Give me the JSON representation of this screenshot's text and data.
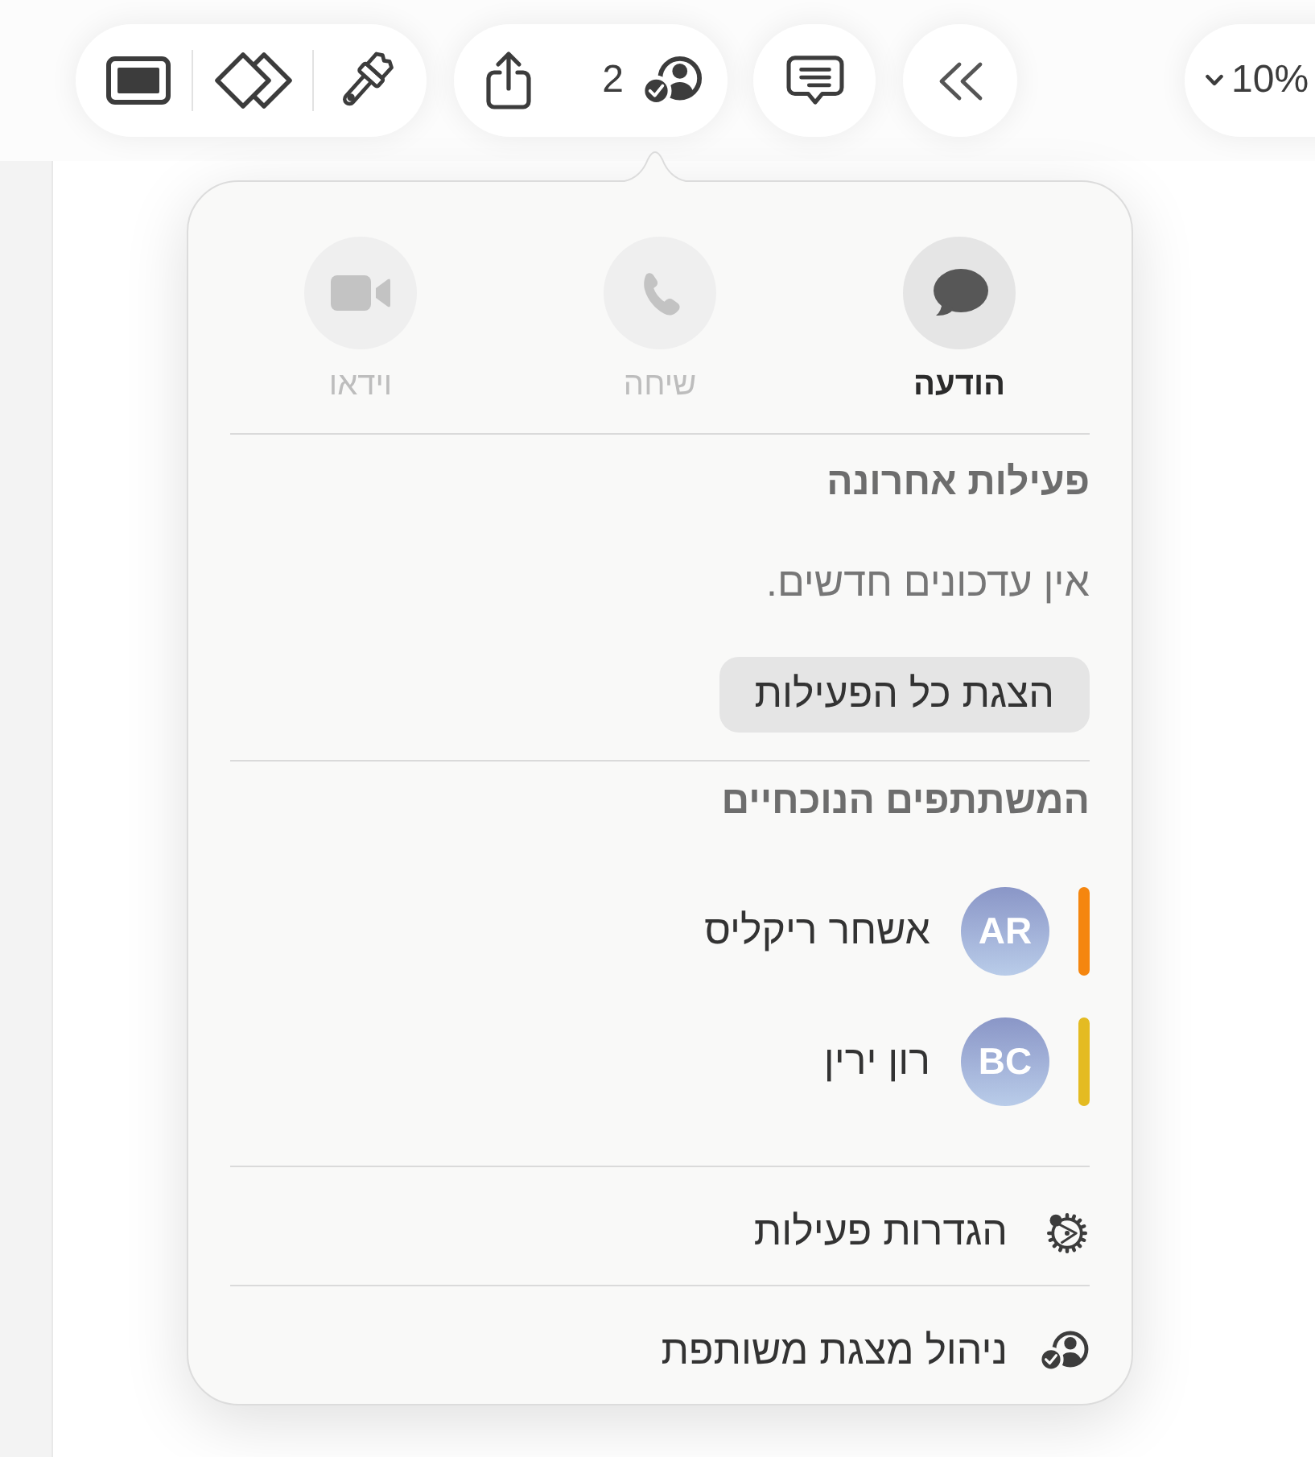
{
  "toolbar": {
    "collaborator_count": "2",
    "zoom": "10%"
  },
  "popover": {
    "actions": [
      {
        "kind": "message",
        "label": "הודעה",
        "disabled": false
      },
      {
        "kind": "call",
        "label": "שיחה",
        "disabled": true
      },
      {
        "kind": "video",
        "label": "וידאו",
        "disabled": true
      }
    ],
    "recent_activity": {
      "heading": "פעילות אחרונה",
      "message": "אין עדכונים חדשים.",
      "button": "הצגת כל הפעילות"
    },
    "participants": {
      "heading": "המשתתפים הנוכחיים",
      "people": [
        {
          "initials": "AR",
          "name": "אשחר ריקליס",
          "color": "#f5860f"
        },
        {
          "initials": "BC",
          "name": "רון ירין",
          "color": "#e4bb22"
        }
      ]
    },
    "menu": [
      {
        "kind": "settings",
        "label": "הגדרות פעילות"
      },
      {
        "kind": "manage",
        "label": "ניהול מצגת משותפת"
      }
    ]
  }
}
